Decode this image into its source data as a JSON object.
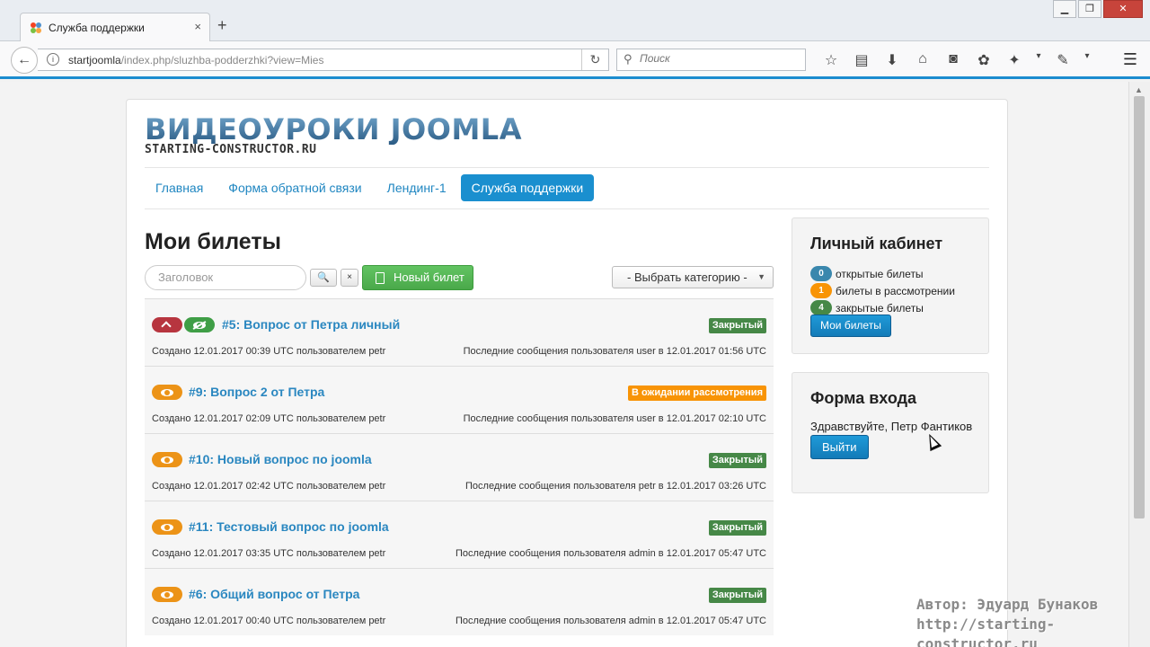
{
  "browser": {
    "tab_title": "Служба поддержки",
    "tab_close": "×",
    "new_tab": "+",
    "url_host": "startjoomla",
    "url_path": "/index.php/sluzhba-podderzhki?view=Mies",
    "search_placeholder": "Поиск",
    "toolbar_icons": [
      "star-icon",
      "reading-list-icon",
      "download-icon",
      "home-icon",
      "pocket-icon",
      "extension-icon",
      "addon-icon",
      "dropdown-icon",
      "tools-icon",
      "dropdown-icon"
    ]
  },
  "site": {
    "logo_title": "ВИДЕОУРОКИ JOOMLA",
    "logo_subtitle": "STARTING-CONSTRUCTOR.RU",
    "menu": [
      {
        "label": "Главная"
      },
      {
        "label": "Форма обратной связи"
      },
      {
        "label": "Лендинг-1"
      },
      {
        "label": "Служба поддержки",
        "active": true
      }
    ]
  },
  "main": {
    "heading": "Мои билеты",
    "filter": {
      "search_placeholder": "Заголовок",
      "search_btn": "🔍",
      "clear_btn": "×",
      "new_ticket": "Новый билет",
      "category_select": "- Выбрать категорию -"
    },
    "tickets": [
      {
        "title": "#5: Вопрос от Петра личный",
        "status": "Закрытый",
        "status_color": "#468847",
        "created": "Создано 12.01.2017 00:39 UTC пользователем petr",
        "last": "Последние сообщения пользователя user в 12.01.2017 01:56 UTC",
        "icons": [
          "priority-high-icon",
          "hidden-icon"
        ]
      },
      {
        "title": "#9: Вопрос 2 от Петра",
        "status": "В ожидании рассмотрения",
        "status_color": "#f89406",
        "created": "Создано 12.01.2017 02:09 UTC пользователем petr",
        "last": "Последние сообщения пользователя user в 12.01.2017 02:10 UTC",
        "icons": [
          "public-icon"
        ]
      },
      {
        "title": "#10: Новый вопрос по joomla",
        "status": "Закрытый",
        "status_color": "#468847",
        "created": "Создано 12.01.2017 02:42 UTC пользователем petr",
        "last": "Последние сообщения пользователя petr в 12.01.2017 03:26 UTC",
        "icons": [
          "public-icon"
        ]
      },
      {
        "title": "#11: Тестовый вопрос по joomla",
        "status": "Закрытый",
        "status_color": "#468847",
        "created": "Создано 12.01.2017 03:35 UTC пользователем petr",
        "last": "Последние сообщения пользователя admin в 12.01.2017 05:47 UTC",
        "icons": [
          "public-icon"
        ]
      },
      {
        "title": "#6: Общий вопрос от Петра",
        "status": "Закрытый",
        "status_color": "#468847",
        "created": "Создано 12.01.2017 00:40 UTC пользователем petr",
        "last": "Последние сообщения пользователя admin в 12.01.2017 05:47 UTC",
        "icons": [
          "public-icon"
        ]
      }
    ]
  },
  "sidebar": {
    "cabinet": {
      "title": "Личный кабинет",
      "stats": [
        {
          "count": "0",
          "label": "открытые билеты",
          "color": "#3a87ad"
        },
        {
          "count": "1",
          "label": "билеты в рассмотрении",
          "color": "#f89406"
        },
        {
          "count": "4",
          "label": "закрытые билеты",
          "color": "#468847"
        }
      ],
      "button": "Мои билеты"
    },
    "login": {
      "title": "Форма входа",
      "greeting": "Здравствуйте, Петр Фантиков",
      "logout": "Выйти"
    }
  },
  "watermark": {
    "line1": "Автор:  Эдуард Бунаков",
    "line2": "http://starting-constructor.ru"
  }
}
